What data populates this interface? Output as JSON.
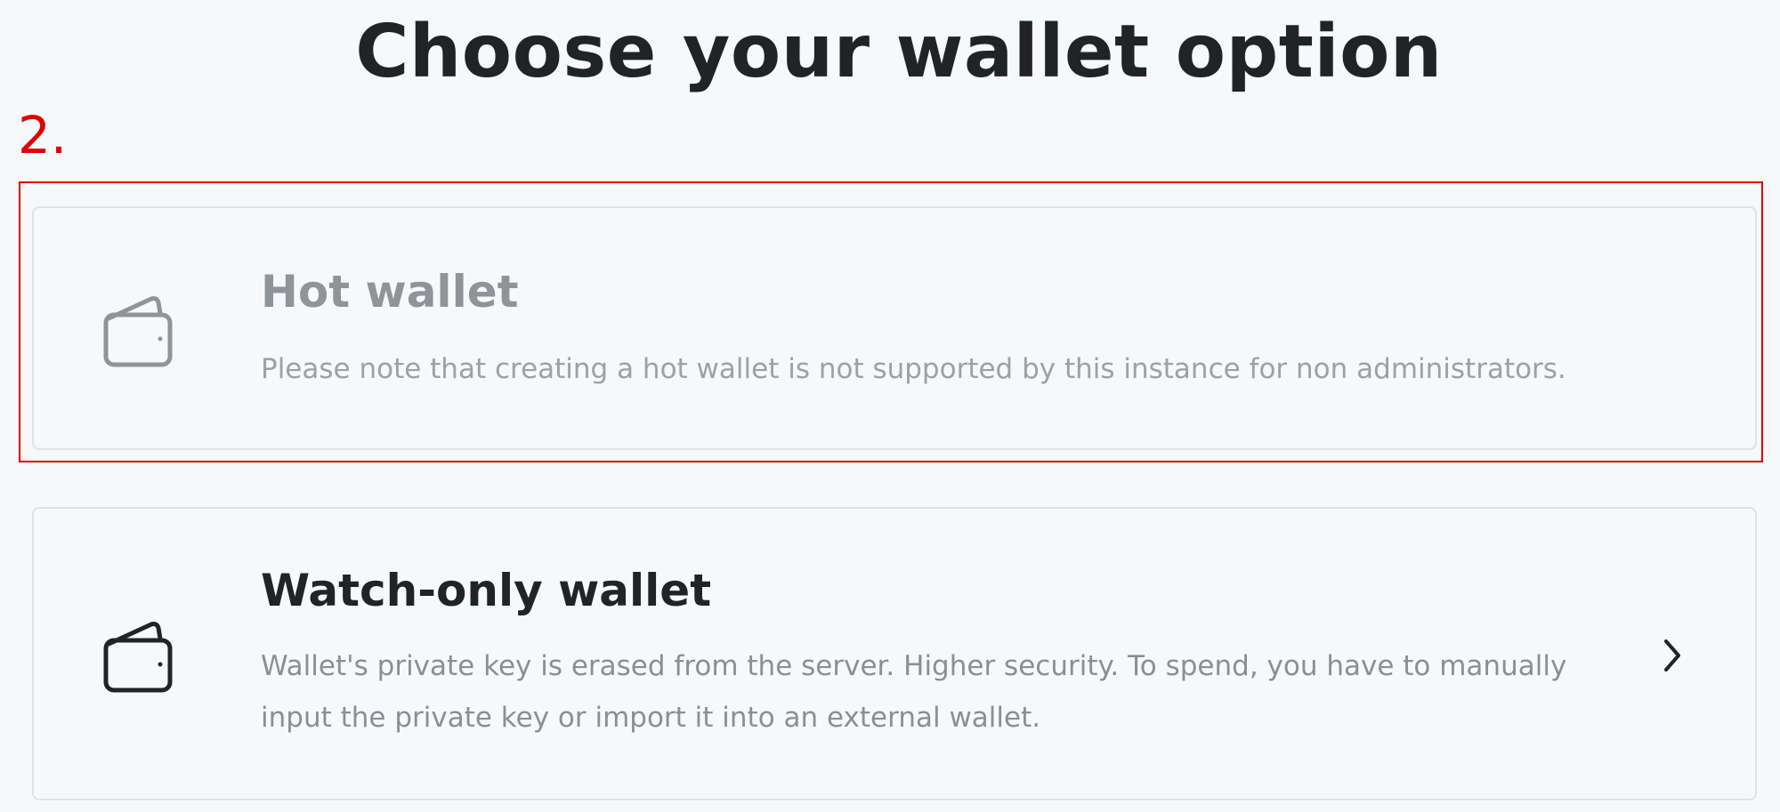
{
  "page": {
    "title": "Choose your wallet option",
    "step_annotation": "2."
  },
  "options": [
    {
      "title": "Hot wallet",
      "description": "Please note that creating a hot wallet is not supported by this instance for non administrators.",
      "icon": "wallet-icon",
      "state": "disabled",
      "highlighted": true
    },
    {
      "title": "Watch-only wallet",
      "description": "Wallet's private key is erased from the server. Higher security. To spend, you have to manually input the private key or import it into an external wallet.",
      "icon": "wallet-icon",
      "state": "enabled",
      "action_icon": "chevron-right-icon"
    }
  ],
  "colors": {
    "highlight": "#e00000",
    "text_primary": "#222326",
    "text_muted": "#8a8f96",
    "card_border": "#dfe2e6",
    "background": "#f7f8fa"
  }
}
